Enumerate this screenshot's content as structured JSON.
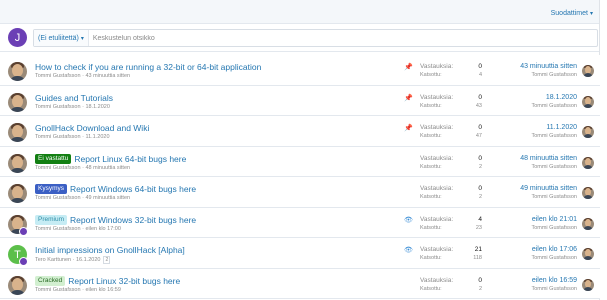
{
  "toolbar": {
    "filters_label": "Suodattimet",
    "filters_caret": "▾"
  },
  "quick_thread": {
    "avatar_letter": "J",
    "prefix_label": "(Ei etuliitettä)",
    "prefix_caret": "▾",
    "title_placeholder": "Keskustelun otsikko"
  },
  "labels": {
    "replies": "Vastauksia:",
    "views": "Katsottu:"
  },
  "threads": [
    {
      "title": "How to check if you are running a 32-bit or 64-bit application",
      "prefix": "",
      "author": "Tommi Gustafsson",
      "date": "43 minuuttia sitten",
      "status_icon": "pin-icon",
      "replies": "0",
      "views": "4",
      "last_time": "43 minuuttia sitten",
      "last_user": "Tommi Gustafsson"
    },
    {
      "title": "Guides and Tutorials",
      "prefix": "",
      "author": "Tommi Gustafsson",
      "date": "18.1.2020",
      "status_icon": "pin-icon",
      "replies": "0",
      "views": "43",
      "last_time": "18.1.2020",
      "last_user": "Tommi Gustafsson"
    },
    {
      "title": "GnollHack Download and Wiki",
      "prefix": "",
      "author": "Tommi Gustafsson",
      "date": "11.1.2020",
      "status_icon": "pin-icon",
      "replies": "0",
      "views": "47",
      "last_time": "11.1.2020",
      "last_user": "Tommi Gustafsson"
    },
    {
      "title": "Report Linux 64-bit bugs here",
      "prefix": "Ei vastattu",
      "author": "Tommi Gustafsson",
      "date": "48 minuuttia sitten",
      "status_icon": "",
      "replies": "0",
      "views": "2",
      "last_time": "48 minuuttia sitten",
      "last_user": "Tommi Gustafsson"
    },
    {
      "title": "Report Windows 64-bit bugs here",
      "prefix": "Kysymys",
      "author": "Tommi Gustafsson",
      "date": "49 minuuttia sitten",
      "status_icon": "",
      "replies": "0",
      "views": "2",
      "last_time": "49 minuuttia sitten",
      "last_user": "Tommi Gustafsson"
    },
    {
      "title": "Report Windows 32-bit bugs here",
      "prefix": "Premium",
      "author": "Tommi Gustafsson",
      "date": "eilen klo 17:00",
      "status_icon": "eye-icon",
      "replies": "4",
      "views": "23",
      "last_time": "eilen klo 21:01",
      "last_user": "Tommi Gustafsson"
    },
    {
      "title": "Initial impressions on GnollHack [Alpha]",
      "prefix": "",
      "author": "Tero Karttunen",
      "date": "16.1.2020",
      "page": "2",
      "status_icon": "eye-icon",
      "replies": "21",
      "views": "118",
      "last_time": "eilen klo 17:06",
      "last_user": "Tommi Gustafsson",
      "avatar_letter": "T"
    },
    {
      "title": "Report Linux 32-bit bugs here",
      "prefix": "Cracked",
      "author": "Tommi Gustafsson",
      "date": "eilen klo 16:59",
      "status_icon": "",
      "replies": "0",
      "views": "2",
      "last_time": "eilen klo 16:59",
      "last_user": "Tommi Gustafsson"
    }
  ],
  "colors": {
    "link": "#2577b1",
    "prefix_unanswered": "#127f12",
    "prefix_question": "#3b5fc4",
    "prefix_premium": "#c6ecf4",
    "prefix_cracked": "#d2efd0"
  }
}
